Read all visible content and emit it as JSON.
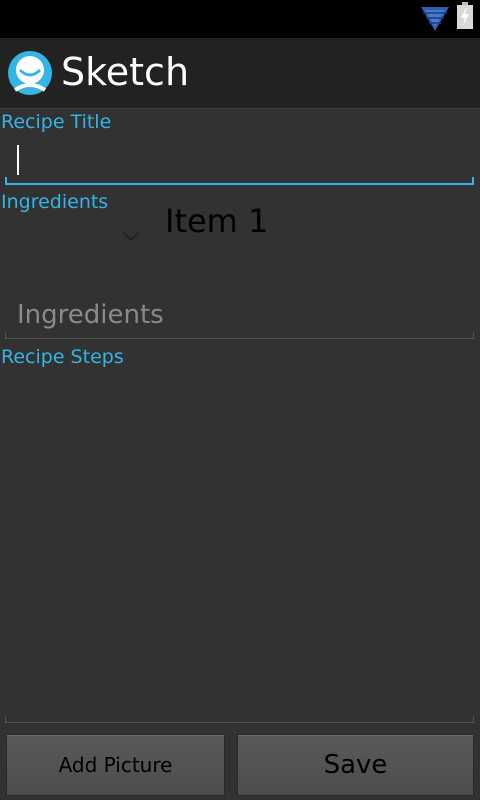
{
  "status_bar": {
    "icons": [
      "wifi-icon",
      "battery-charging-icon"
    ],
    "wifi_color": "#4a78c8"
  },
  "action_bar": {
    "title": "Sketch",
    "logo_icon": "app-logo-icon",
    "logo_color": "#33b5e5"
  },
  "form": {
    "recipe_title_label": "Recipe Title",
    "recipe_title_value": "",
    "ingredients_label": "Ingredients",
    "ingredients_spinner_value": "Item 1",
    "ingredients_placeholder": "Ingredients",
    "recipe_steps_label": "Recipe Steps",
    "recipe_steps_value": ""
  },
  "buttons": {
    "add_picture": "Add Picture",
    "save": "Save"
  },
  "colors": {
    "accent": "#33b5e5",
    "background": "#323232",
    "action_bar": "#222222"
  }
}
